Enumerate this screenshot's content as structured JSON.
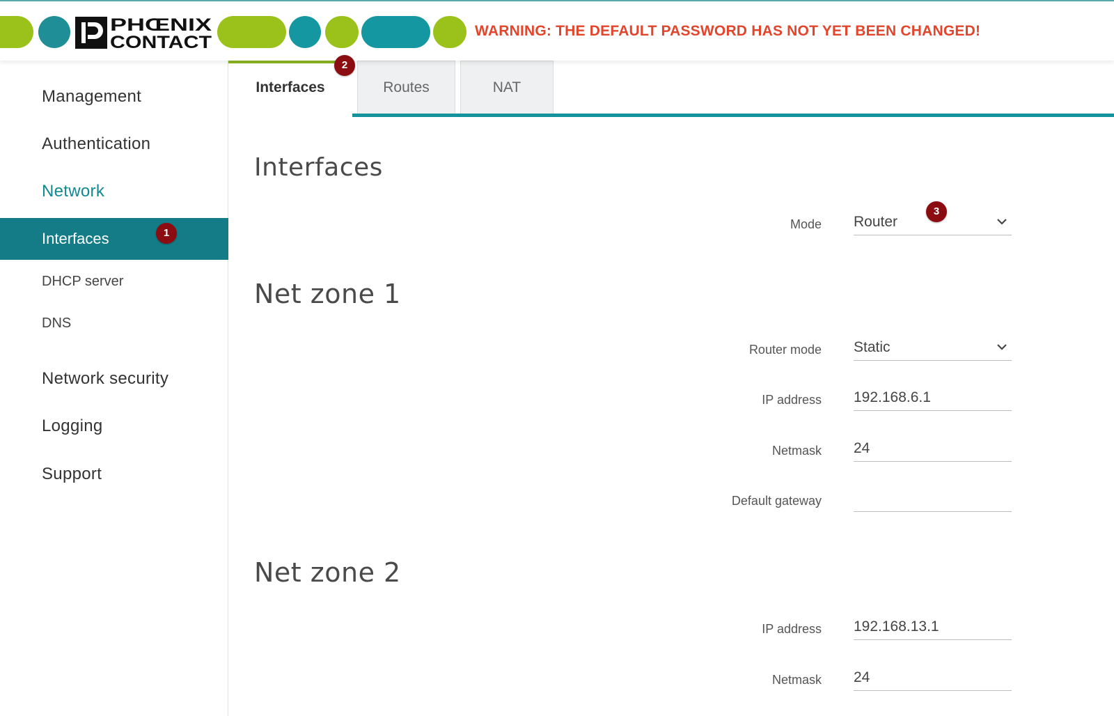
{
  "header": {
    "brand_line1": "PHŒNIX",
    "brand_line2": "CONTACT",
    "warning": "WARNING: THE DEFAULT PASSWORD HAS NOT YET BEEN CHANGED!",
    "colors": {
      "green": "#9bc21a",
      "teal": "#1497a1",
      "warning": "#e2452b"
    }
  },
  "sidebar": {
    "items": [
      {
        "label": "Management"
      },
      {
        "label": "Authentication"
      },
      {
        "label": "Network"
      },
      {
        "label": "Interfaces"
      },
      {
        "label": "DHCP server"
      },
      {
        "label": "DNS"
      },
      {
        "label": "Network security"
      },
      {
        "label": "Logging"
      },
      {
        "label": "Support"
      }
    ]
  },
  "badges": {
    "b1": "1",
    "b2": "2",
    "b3": "3"
  },
  "tabs": [
    {
      "label": "Interfaces"
    },
    {
      "label": "Routes"
    },
    {
      "label": "NAT"
    }
  ],
  "main": {
    "title": "Interfaces",
    "mode": {
      "label": "Mode",
      "value": "Router"
    },
    "zone1": {
      "title": "Net zone 1",
      "router_mode": {
        "label": "Router mode",
        "value": "Static"
      },
      "ip": {
        "label": "IP address",
        "value": "192.168.6.1"
      },
      "netmask": {
        "label": "Netmask",
        "value": "24"
      },
      "gateway": {
        "label": "Default gateway",
        "value": ""
      }
    },
    "zone2": {
      "title": "Net zone 2",
      "ip": {
        "label": "IP address",
        "value": "192.168.13.1"
      },
      "netmask": {
        "label": "Netmask",
        "value": "24"
      }
    }
  }
}
